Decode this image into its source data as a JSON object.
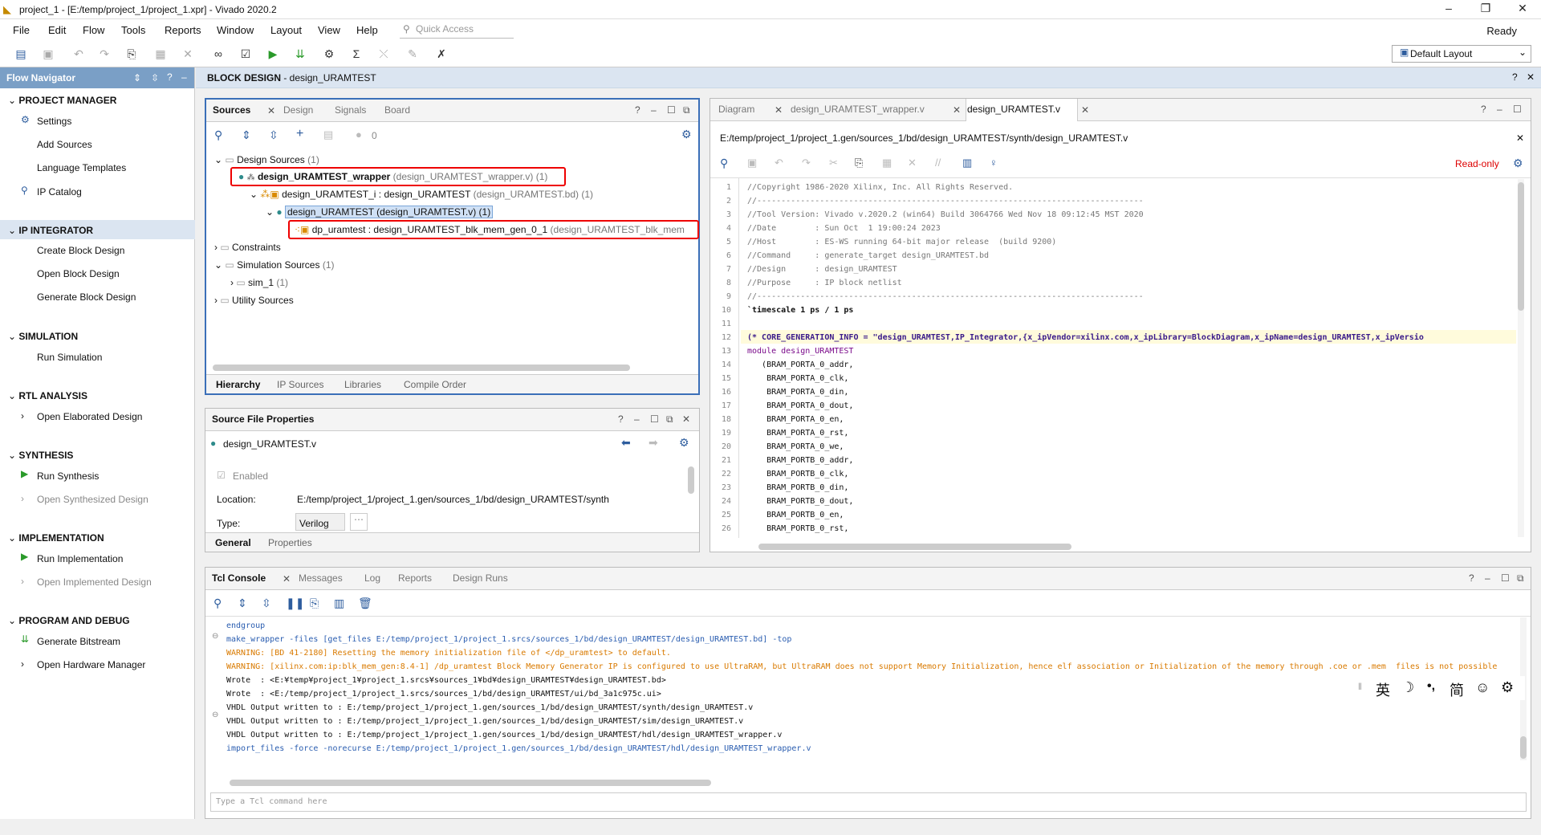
{
  "window": {
    "title": "project_1 - [E:/temp/project_1/project_1.xpr] - Vivado 2020.2",
    "status": "Ready"
  },
  "menu": [
    "File",
    "Edit",
    "Flow",
    "Tools",
    "Reports",
    "Window",
    "Layout",
    "View",
    "Help"
  ],
  "quick_access": "Quick Access",
  "layout_select": "Default Layout",
  "flow_nav": {
    "title": "Flow Navigator",
    "sections": {
      "pm": "PROJECT MANAGER",
      "ipi": "IP INTEGRATOR",
      "sim": "SIMULATION",
      "rtl": "RTL ANALYSIS",
      "syn": "SYNTHESIS",
      "impl": "IMPLEMENTATION",
      "pad": "PROGRAM AND DEBUG"
    },
    "items": {
      "settings": "Settings",
      "add_sources": "Add Sources",
      "lang_templates": "Language Templates",
      "ip_catalog": "IP Catalog",
      "create_bd": "Create Block Design",
      "open_bd": "Open Block Design",
      "gen_bd": "Generate Block Design",
      "run_sim": "Run Simulation",
      "open_elab": "Open Elaborated Design",
      "run_syn": "Run Synthesis",
      "open_syn": "Open Synthesized Design",
      "run_impl": "Run Implementation",
      "open_impl": "Open Implemented Design",
      "gen_bit": "Generate Bitstream",
      "open_hw": "Open Hardware Manager"
    }
  },
  "block_design_header": {
    "label": "BLOCK DESIGN",
    "name": " - design_URAMTEST"
  },
  "sources": {
    "tabs": [
      "Sources",
      "Design",
      "Signals",
      "Board"
    ],
    "count": "0",
    "tree": {
      "design_sources": "Design Sources",
      "design_sources_count": "(1)",
      "wrapper": "design_URAMTEST_wrapper",
      "wrapper_file": "(design_URAMTEST_wrapper.v) (1)",
      "inst_i": "design_URAMTEST_i : design_URAMTEST",
      "inst_i_file": "(design_URAMTEST.bd) (1)",
      "dut": "design_URAMTEST (design_URAMTEST.v) (1)",
      "uram": "dp_uramtest : design_URAMTEST_blk_mem_gen_0_1",
      "uram_file": "(design_URAMTEST_blk_mem",
      "constraints": "Constraints",
      "sim_sources": "Simulation Sources",
      "sim_sources_count": "(1)",
      "sim1": "sim_1",
      "sim1_count": "(1)",
      "utility": "Utility Sources"
    },
    "bottom_tabs": [
      "Hierarchy",
      "IP Sources",
      "Libraries",
      "Compile Order"
    ]
  },
  "sfp": {
    "title": "Source File Properties",
    "file": "design_URAMTEST.v",
    "enabled": "Enabled",
    "location_label": "Location:",
    "location": "E:/temp/project_1/project_1.gen/sources_1/bd/design_URAMTEST/synth",
    "type_label": "Type:",
    "type": "Verilog",
    "tabs": [
      "General",
      "Properties"
    ]
  },
  "editor": {
    "tabs": [
      "Diagram",
      "design_URAMTEST_wrapper.v",
      "design_URAMTEST.v"
    ],
    "path": "E:/temp/project_1/project_1.gen/sources_1/bd/design_URAMTEST/synth/design_URAMTEST.v",
    "readonly": "Read-only",
    "lines": [
      "//Copyright 1986-2020 Xilinx, Inc. All Rights Reserved.",
      "//--------------------------------------------------------------------------------",
      "//Tool Version: Vivado v.2020.2 (win64) Build 3064766 Wed Nov 18 09:12:45 MST 2020",
      "//Date        : Sun Oct  1 19:00:24 2023",
      "//Host        : ES-WS running 64-bit major release  (build 9200)",
      "//Command     : generate_target design_URAMTEST.bd",
      "//Design      : design_URAMTEST",
      "//Purpose     : IP block netlist",
      "//--------------------------------------------------------------------------------",
      "`timescale 1 ps / 1 ps",
      "",
      "(* CORE_GENERATION_INFO = \"design_URAMTEST,IP_Integrator,{x_ipVendor=xilinx.com,x_ipLibrary=BlockDiagram,x_ipName=design_URAMTEST,x_ipVersio",
      "module design_URAMTEST",
      "   (BRAM_PORTA_0_addr,",
      "    BRAM_PORTA_0_clk,",
      "    BRAM_PORTA_0_din,",
      "    BRAM_PORTA_0_dout,",
      "    BRAM_PORTA_0_en,",
      "    BRAM_PORTA_0_rst,",
      "    BRAM_PORTA_0_we,",
      "    BRAM_PORTB_0_addr,",
      "    BRAM_PORTB_0_clk,",
      "    BRAM_PORTB_0_din,",
      "    BRAM_PORTB_0_dout,",
      "    BRAM_PORTB_0_en,",
      "    BRAM_PORTB_0_rst,",
      "    BRAM_PORTB_0_we);"
    ]
  },
  "console": {
    "tabs": [
      "Tcl Console",
      "Messages",
      "Log",
      "Reports",
      "Design Runs"
    ],
    "lines": [
      {
        "t": "endgroup",
        "c": "#2a5db0"
      },
      {
        "t": "make_wrapper -files [get_files E:/temp/project_1/project_1.srcs/sources_1/bd/design_URAMTEST/design_URAMTEST.bd] -top",
        "c": "#2a5db0"
      },
      {
        "t": "WARNING: [BD 41-2180] Resetting the memory initialization file of </dp_uramtest> to default.",
        "c": "#d97a00"
      },
      {
        "t": "WARNING: [xilinx.com:ip:blk_mem_gen:8.4-1] /dp_uramtest Block Memory Generator IP is configured to use UltraRAM, but UltraRAM does not support Memory Initialization, hence elf association or Initialization of the memory through .coe or .mem  files is not possible",
        "c": "#d97a00"
      },
      {
        "t": "Wrote  : <E:¥temp¥project_1¥project_1.srcs¥sources_1¥bd¥design_URAMTEST¥design_URAMTEST.bd>",
        "c": "#111"
      },
      {
        "t": "Wrote  : <E:/temp/project_1/project_1.srcs/sources_1/bd/design_URAMTEST/ui/bd_3a1c975c.ui>",
        "c": "#111"
      },
      {
        "t": "VHDL Output written to : E:/temp/project_1/project_1.gen/sources_1/bd/design_URAMTEST/synth/design_URAMTEST.v",
        "c": "#111"
      },
      {
        "t": "VHDL Output written to : E:/temp/project_1/project_1.gen/sources_1/bd/design_URAMTEST/sim/design_URAMTEST.v",
        "c": "#111"
      },
      {
        "t": "VHDL Output written to : E:/temp/project_1/project_1.gen/sources_1/bd/design_URAMTEST/hdl/design_URAMTEST_wrapper.v",
        "c": "#111"
      },
      {
        "t": "import_files -force -norecurse E:/temp/project_1/project_1.gen/sources_1/bd/design_URAMTEST/hdl/design_URAMTEST_wrapper.v",
        "c": "#2a5db0"
      }
    ],
    "placeholder": "Type a Tcl command here"
  },
  "ime": [
    "英",
    "☽",
    "•,",
    "简",
    "☺",
    "⚙"
  ]
}
